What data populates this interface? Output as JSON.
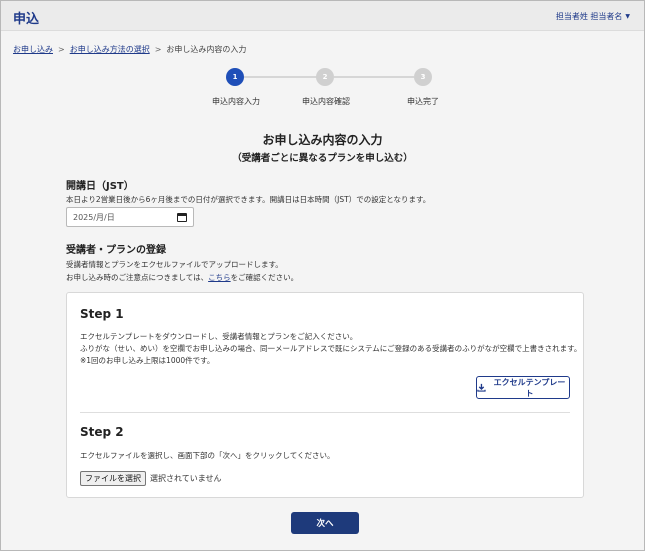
{
  "header": {
    "title": "申込",
    "user_name": "担当者姓 担当者名"
  },
  "breadcrumb": {
    "items": [
      "お申し込み",
      "お申し込み方法の選択",
      "お申し込み内容の入力"
    ],
    "separator": ">"
  },
  "stepper": {
    "steps": [
      {
        "number": "1",
        "label": "申込内容入力",
        "active": true
      },
      {
        "number": "2",
        "label": "申込内容確認",
        "active": false
      },
      {
        "number": "3",
        "label": "申込完了",
        "active": false
      }
    ]
  },
  "page": {
    "title": "お申し込み内容の入力",
    "subtitle": "（受講者ごとに異なるプランを申し込む）"
  },
  "start_date": {
    "title": "開講日（JST）",
    "description": "本日より2営業日後から6ヶ月後までの日付が選択できます。開講日は日本時間（JST）での設定となります。",
    "placeholder": "2025/月/日"
  },
  "registration": {
    "title": "受講者・プランの登録",
    "description_line1": "受講者情報とプランをエクセルファイルでアップロードします。",
    "description_line2_before": "お申し込み時のご注意点につきましては、",
    "description_link": "こちら",
    "description_line2_after": "をご確認ください。"
  },
  "step1": {
    "title": "Step 1",
    "line1": "エクセルテンプレートをダウンロードし、受講者情報とプランをご記入ください。",
    "line2": "ふりがな（せい、めい）を空欄でお申し込みの場合、同一メールアドレスで既にシステムにご登録のある受講者のふりがなが空欄で上書きされます。",
    "line3": "※1回のお申し込み上限は1000件です。",
    "template_button": "エクセルテンプレート"
  },
  "step2": {
    "title": "Step 2",
    "line1": "エクセルファイルを選択し、画面下部の「次へ」をクリックしてください。",
    "file_button": "ファイルを選択",
    "file_status": "選択されていません"
  },
  "footer": {
    "next_button": "次へ"
  },
  "colors": {
    "accent": "#1f4fb8",
    "primary_dark": "#1e3a7b",
    "link": "#1f3a8a"
  }
}
